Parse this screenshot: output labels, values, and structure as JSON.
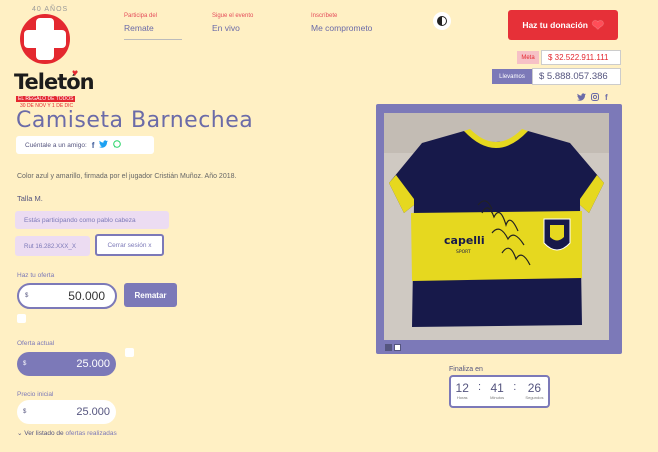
{
  "logo": {
    "years": "40 AÑOS",
    "brand": "Teletón",
    "slogan": "EL REGALO DE TODOS",
    "dates": "30 DE NOV Y 1 DE DIC"
  },
  "nav": [
    {
      "small": "Participa del",
      "big": "Remate",
      "active": true
    },
    {
      "small": "Sigue el evento",
      "big": "En vivo",
      "active": false
    },
    {
      "small": "Inscríbete",
      "big": "Me comprometo",
      "active": false
    }
  ],
  "header": {
    "donate_label": "Haz tu donación",
    "meta_label": "Meta",
    "meta_value": "$ 32.522.911.111",
    "llevamos_label": "Llevamos",
    "llevamos_value": "$ 5.888.057.386",
    "social_icons": [
      "twitter-icon",
      "instagram-icon",
      "facebook-icon"
    ]
  },
  "product": {
    "title": "Camiseta Barnechea",
    "share_label": "Cuéntale a un amigo:",
    "description": "Color azul y amarillo, firmada por el jugador Cristián Muñoz. Año 2018.",
    "talla": "Talla M.",
    "participating": "Estás participando como pablo cabeza",
    "rut": "Rut 16.282.XXX_X",
    "logout": "Cerrar sesión x",
    "jersey_brand": "capelli",
    "jersey_brand_sub": "SPORT",
    "jersey_crest": "A.C. BARNECHEA"
  },
  "bid": {
    "offer_label": "Haz tu oferta",
    "currency": "$",
    "offer_value": "50.000",
    "submit_label": "Rematar",
    "current_label": "Oferta actual",
    "current_value": "25.000",
    "initial_label": "Precio inicial",
    "initial_value": "25.000",
    "list_prefix": "Ver listado de",
    "list_link": "ofertas realizadas"
  },
  "countdown": {
    "label": "Finaliza en",
    "hours": "12",
    "minutes": "41",
    "seconds": "26",
    "hours_label": "Horas",
    "minutes_label": "Minutos",
    "seconds_label": "Segundos"
  },
  "colors": {
    "background": "#fff0c4",
    "accent": "#7c79b8",
    "brand_red": "#e4282f"
  }
}
